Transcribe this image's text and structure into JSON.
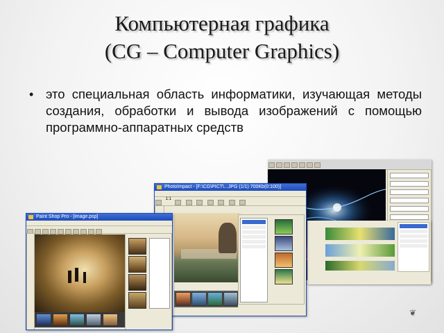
{
  "slide": {
    "title_line1": "Компьютерная графика",
    "title_line2": "(CG – Computer Graphics)",
    "bullets": [
      "это специальная область информатики, изучающая методы создания, обработки и вывода изображений с помощью программно-аппаратных средств"
    ]
  },
  "screenshots": {
    "left_window_title": "Paint Shop Pro - [image.psp]",
    "middle_window_title": "PhotoImpact - [F:\\CG\\PICT\\...JPG (1/1) 700Kb(0:100)]",
    "middle_zoom": "1:1"
  },
  "colors": {
    "xp_title_blue": "#1d4bb8",
    "xp_panel": "#ece9d8",
    "background_light": "#f3f3f3"
  },
  "icons": {
    "bullet": "bullet-dot-icon",
    "decoration": "fleur-icon"
  }
}
